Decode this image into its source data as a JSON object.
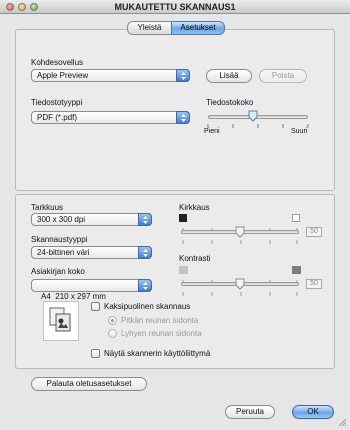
{
  "window": {
    "title": "MUKAUTETTU SKANNAUS1"
  },
  "tabs": [
    {
      "label": "Yleistä",
      "active": false
    },
    {
      "label": "Asetukset",
      "active": true
    }
  ],
  "app_section": {
    "label": "Kohdesovellus",
    "selected": "Apple Preview",
    "add_label": "Lisää",
    "delete_label": "Poista"
  },
  "file_type": {
    "label": "Tiedostotyyppi",
    "selected": "PDF (*.pdf)"
  },
  "file_size": {
    "label": "Tiedostokoko",
    "min_label": "Pieni",
    "max_label": "Suuri",
    "level": 0.45
  },
  "resolution": {
    "label": "Tarkkuus",
    "selected": "300 x 300 dpi"
  },
  "scan_type": {
    "label": "Skannaustyyppi",
    "selected": "24-bittinen väri"
  },
  "doc_size": {
    "label": "Asiakirjan koko",
    "selected": "A4  210 x 297 mm"
  },
  "brightness": {
    "label": "Kirkkaus",
    "value": "50",
    "level": 0.5
  },
  "contrast": {
    "label": "Kontrasti",
    "value": "50",
    "level": 0.5
  },
  "duplex": {
    "label": "Kaksipuolinen skannaus",
    "checked": false,
    "options": [
      {
        "label": "Pitkän reunan sidonta",
        "selected": true
      },
      {
        "label": "Lyhyen reunan sidonta",
        "selected": false
      }
    ]
  },
  "show_scanner_ui": {
    "label": "Näytä skannerin käyttöliittymä",
    "checked": false
  },
  "buttons": {
    "restore_defaults": "Palauta oletusasetukset",
    "cancel": "Peruuta",
    "ok": "OK"
  },
  "colors": {
    "accent": "#6aa5e6",
    "panel": "#ebebeb",
    "window": "#e6e6e6"
  }
}
